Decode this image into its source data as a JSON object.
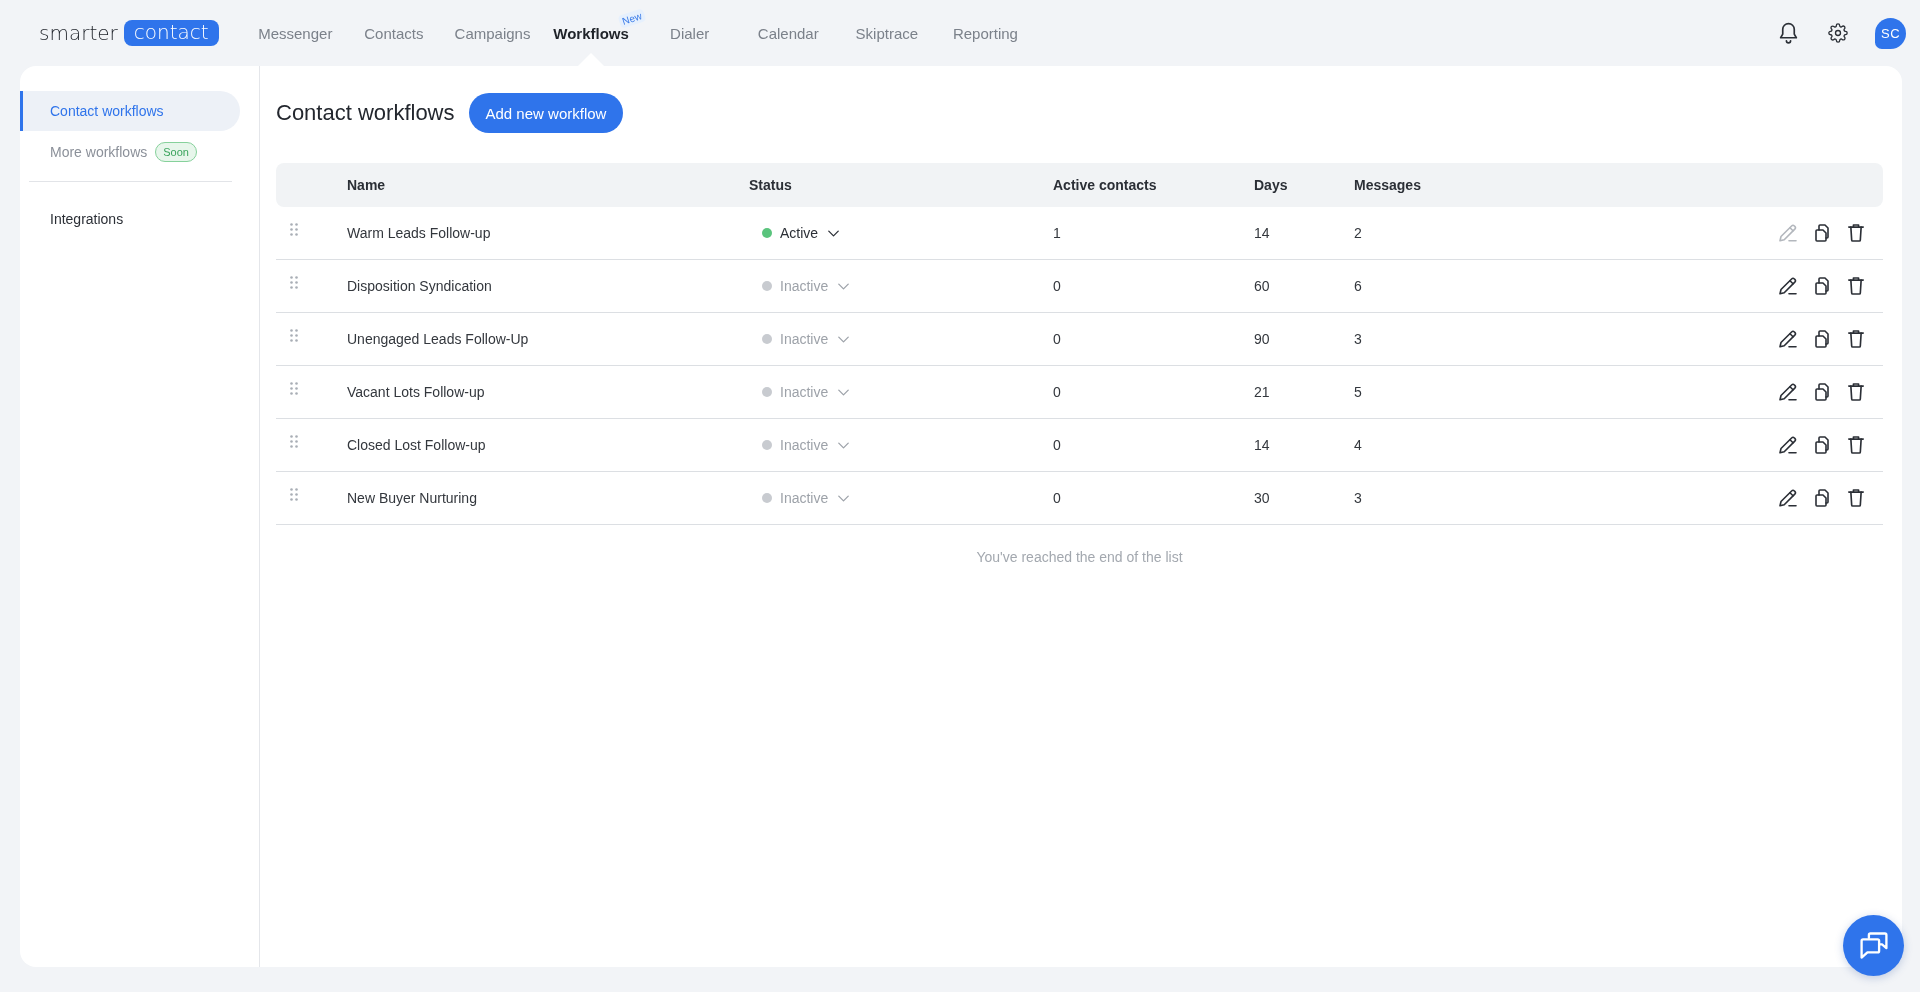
{
  "header": {
    "logo": {
      "text": "smarter",
      "highlight": "contact"
    },
    "nav": [
      {
        "label": "Messenger",
        "selected": false
      },
      {
        "label": "Contacts",
        "selected": false
      },
      {
        "label": "Campaigns",
        "selected": false
      },
      {
        "label": "Workflows",
        "selected": true,
        "badge": "New"
      },
      {
        "label": "Dialer",
        "selected": false
      },
      {
        "label": "Calendar",
        "selected": false
      },
      {
        "label": "Skiptrace",
        "selected": false
      },
      {
        "label": "Reporting",
        "selected": false
      }
    ],
    "avatar": {
      "initials": "SC"
    }
  },
  "sidebar": {
    "groups": [
      {
        "items": [
          {
            "label": "Contact workflows",
            "selected": true,
            "disabled": false
          },
          {
            "label": "More workflows",
            "selected": false,
            "disabled": true,
            "badge": "Soon"
          }
        ]
      },
      {
        "items": [
          {
            "label": "Integrations",
            "selected": false,
            "disabled": false
          }
        ]
      }
    ]
  },
  "page": {
    "title": "Contact workflows",
    "primary_button": "Add new workflow"
  },
  "table": {
    "columns": [
      "Name",
      "Status",
      "Active contacts",
      "Days",
      "Messages"
    ],
    "rows": [
      {
        "name": "Warm Leads Follow-up",
        "status": "Active",
        "active": true,
        "active_contacts": "1",
        "days": "14",
        "messages": "2",
        "edit_disabled": true
      },
      {
        "name": "Disposition Syndication",
        "status": "Inactive",
        "active": false,
        "active_contacts": "0",
        "days": "60",
        "messages": "6",
        "edit_disabled": false
      },
      {
        "name": "Unengaged Leads Follow-Up",
        "status": "Inactive",
        "active": false,
        "active_contacts": "0",
        "days": "90",
        "messages": "3",
        "edit_disabled": false
      },
      {
        "name": "Vacant Lots Follow-up",
        "status": "Inactive",
        "active": false,
        "active_contacts": "0",
        "days": "21",
        "messages": "5",
        "edit_disabled": false
      },
      {
        "name": "Closed Lost Follow-up",
        "status": "Inactive",
        "active": false,
        "active_contacts": "0",
        "days": "14",
        "messages": "4",
        "edit_disabled": false
      },
      {
        "name": "New Buyer Nurturing",
        "status": "Inactive",
        "active": false,
        "active_contacts": "0",
        "days": "30",
        "messages": "3",
        "edit_disabled": false
      }
    ],
    "footer": "You've reached the end of the list"
  }
}
